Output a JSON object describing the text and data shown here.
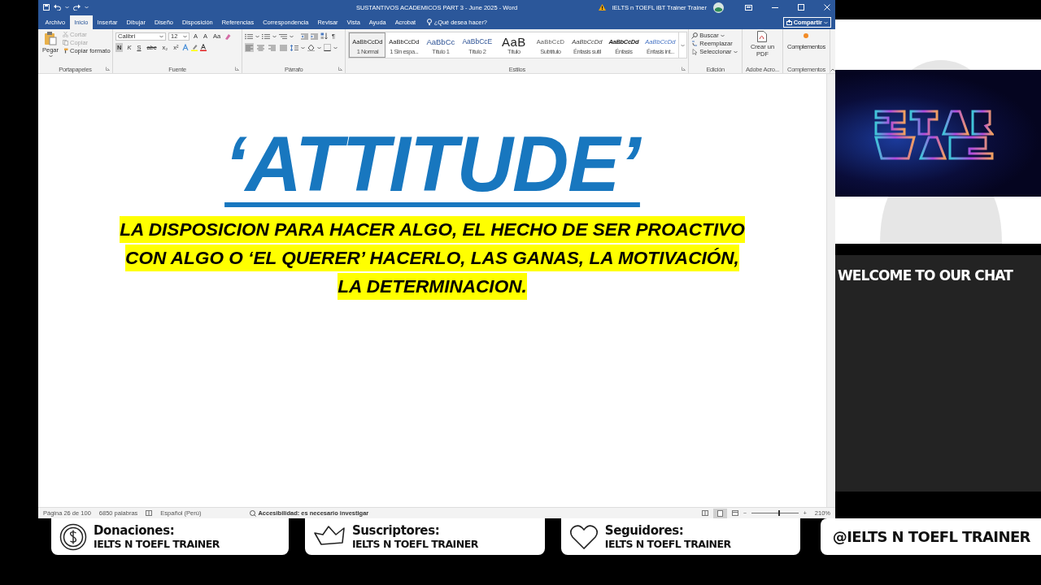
{
  "window": {
    "title": "SUSTANTIVOS ACADEMICOS PART 3 - June 2025 - Word",
    "account": "IELTS n TOEFL iBT Trainer Trainer",
    "share_button": "Compartir"
  },
  "tabs": [
    {
      "label": "Archivo",
      "selected": false
    },
    {
      "label": "Inicio",
      "selected": true
    },
    {
      "label": "Insertar",
      "selected": false
    },
    {
      "label": "Dibujar",
      "selected": false
    },
    {
      "label": "Diseño",
      "selected": false
    },
    {
      "label": "Disposición",
      "selected": false
    },
    {
      "label": "Referencias",
      "selected": false
    },
    {
      "label": "Correspondencia",
      "selected": false
    },
    {
      "label": "Revisar",
      "selected": false
    },
    {
      "label": "Vista",
      "selected": false
    },
    {
      "label": "Ayuda",
      "selected": false
    },
    {
      "label": "Acrobat",
      "selected": false
    }
  ],
  "tell_me": {
    "placeholder": "¿Qué desea hacer?"
  },
  "ribbon": {
    "clipboard": {
      "group": "Portapapeles",
      "paste": "Pegar",
      "items": [
        {
          "kind": "cut",
          "label": "Cortar",
          "disabled": true
        },
        {
          "kind": "copy",
          "label": "Copiar",
          "disabled": true
        },
        {
          "kind": "painter",
          "label": "Copiar formato",
          "disabled": false
        }
      ]
    },
    "font": {
      "group": "Fuente",
      "name": "Calibri",
      "size": "12",
      "size_buttons": [
        "A",
        "A",
        "Aa"
      ],
      "format_buttons": [
        {
          "label": "N",
          "selected": true
        },
        {
          "label": "K",
          "selected": false
        },
        {
          "label": "S",
          "selected": false
        },
        {
          "label": "abc",
          "selected": false
        },
        {
          "label": "x₂",
          "selected": false
        },
        {
          "label": "x²",
          "selected": false
        }
      ]
    },
    "paragraph": {
      "group": "Párrafo",
      "pilcrow": "¶",
      "alignment": [
        {
          "kind": "left",
          "selected": true
        },
        {
          "kind": "center",
          "selected": false
        },
        {
          "kind": "right",
          "selected": false
        },
        {
          "kind": "justify",
          "selected": false
        }
      ]
    },
    "styles": {
      "group": "Estilos",
      "items": [
        {
          "kind": "normal",
          "preview": "AaBbCcDd",
          "label": "1 Normal",
          "selected": true
        },
        {
          "kind": "nospacing",
          "preview": "AaBbCcDd",
          "label": "1 Sin espa...",
          "selected": false
        },
        {
          "kind": "heading1",
          "preview": "AaBbCc",
          "label": "Título 1",
          "selected": false
        },
        {
          "kind": "heading2",
          "preview": "AaBbCcE",
          "label": "Título 2",
          "selected": false
        },
        {
          "kind": "title",
          "preview": "AaB",
          "label": "Título",
          "selected": false
        },
        {
          "kind": "subtitle",
          "preview": "AaBbCcD",
          "label": "Subtítulo",
          "selected": false
        },
        {
          "kind": "subtle",
          "preview": "AaBbCcDd",
          "label": "Énfasis sutil",
          "selected": false
        },
        {
          "kind": "emphasis",
          "preview": "AaBbCcDd",
          "label": "Énfasis",
          "selected": false
        },
        {
          "kind": "intense",
          "preview": "AaBbCcDd",
          "label": "Énfasis int...",
          "selected": false
        }
      ]
    },
    "editing": {
      "group": "Edición",
      "items": [
        {
          "kind": "find",
          "label": "Buscar"
        },
        {
          "kind": "replace",
          "label": "Reemplazar"
        },
        {
          "kind": "select",
          "label": "Seleccionar"
        }
      ]
    },
    "adobe": {
      "group": "Adobe Acro...",
      "button": "Crear un PDF"
    },
    "addins": {
      "group": "Complementos",
      "button": "Complementos"
    }
  },
  "document": {
    "heading": "‘ATTITUDE’",
    "paragraph": "LA DISPOSICION PARA HACER ALGO, EL HECHO DE SER PROACTIVO CON ALGO O ‘EL QUERER’ HACERLO, LAS GANAS, LA MOTIVACIÓN, LA DETERMINACION."
  },
  "status_bar": {
    "page": "Página 26 de 100",
    "words": "6850 palabras",
    "language": "Español (Perú)",
    "accessibility": "Accesibilidad: es necesario investigar",
    "zoom_out": "−",
    "zoom_in": "+",
    "zoom": {
      "level": 0.58
    },
    "zoom_percent": "210%"
  },
  "side_panel": {
    "chat_title": "WELCOME TO OUR CHAT"
  },
  "banners": [
    {
      "kind": "donations",
      "title": "Donaciones:",
      "text": "IELTS N TOEFL TRAINER"
    },
    {
      "kind": "subscribers",
      "title": "Suscriptores:",
      "text": "IELTS N TOEFL TRAINER"
    },
    {
      "kind": "followers",
      "title": "Seguidores:",
      "text": "IELTS N TOEFL TRAINER"
    },
    {
      "kind": "handle",
      "text": "@IELTS N TOEFL TRAINER"
    }
  ]
}
